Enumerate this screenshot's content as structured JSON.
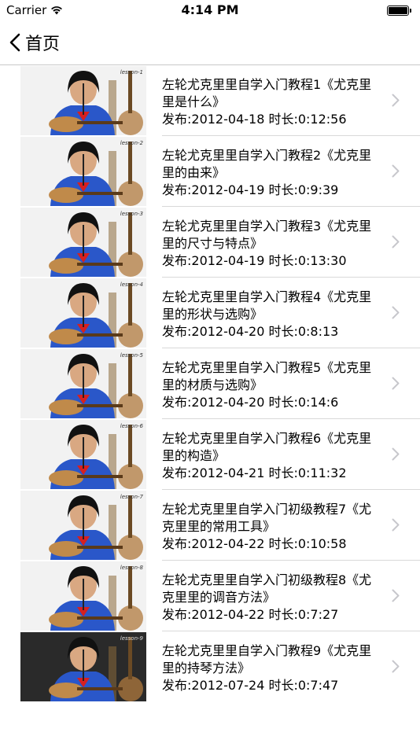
{
  "status_bar": {
    "carrier": "Carrier",
    "time": "4:14 PM"
  },
  "nav": {
    "back_label": "首页",
    "back_icon": "chevron-left-icon"
  },
  "colors": {
    "thumb_bg_light": "#f2f2f2",
    "thumb_bg_dark": "#2a2a2a",
    "hoodie_blue": "#2a57c9",
    "ukulele_wood": "#c08a4a",
    "hair_black": "#111111",
    "skin": "#d9a882",
    "separator": "#d9d9d9",
    "chevron": "#c7c7cc"
  },
  "videos": [
    {
      "title": "左轮尤克里里自学入门教程1《尤克里里是什么》",
      "meta": "发布:2012-04-18 时长:0:12:56",
      "thumb_badge": "lesson-1"
    },
    {
      "title": "左轮尤克里里自学入门教程2《尤克里里的由来》",
      "meta": "发布:2012-04-19 时长:0:9:39",
      "thumb_badge": "lesson-2"
    },
    {
      "title": "左轮尤克里里自学入门教程3《尤克里里的尺寸与特点》",
      "meta": "发布:2012-04-19 时长:0:13:30",
      "thumb_badge": "lesson-3"
    },
    {
      "title": "左轮尤克里里自学入门教程4《尤克里里的形状与选购》",
      "meta": "发布:2012-04-20 时长:0:8:13",
      "thumb_badge": "lesson-4"
    },
    {
      "title": "左轮尤克里里自学入门教程5《尤克里里的材质与选购》",
      "meta": "发布:2012-04-20 时长:0:14:6",
      "thumb_badge": "lesson-5"
    },
    {
      "title": "左轮尤克里里自学入门教程6《尤克里里的构造》",
      "meta": "发布:2012-04-21 时长:0:11:32",
      "thumb_badge": "lesson-6"
    },
    {
      "title": "左轮尤克里里自学入门初级教程7《尤克里里的常用工具》",
      "meta": "发布:2012-04-22 时长:0:10:58",
      "thumb_badge": "lesson-7"
    },
    {
      "title": "左轮尤克里里自学入门初级教程8《尤克里里的调音方法》",
      "meta": "发布:2012-04-22 时长:0:7:27",
      "thumb_badge": "lesson-8"
    },
    {
      "title": "左轮尤克里里自学入门教程9《尤克里里的持琴方法》",
      "meta": "发布:2012-07-24 时长:0:7:47",
      "thumb_badge": "lesson-9"
    }
  ]
}
